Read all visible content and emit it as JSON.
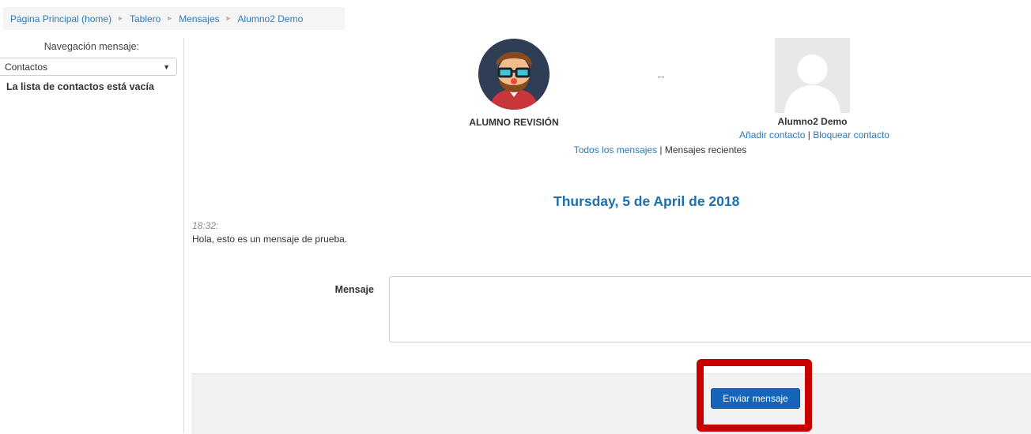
{
  "breadcrumb": {
    "items": [
      "Página Principal (home)",
      "Tablero",
      "Mensajes",
      "Alumno2 Demo"
    ],
    "separator": "►"
  },
  "sidebar": {
    "nav_label": "Navegación mensaje:",
    "select_value": "Contactos",
    "empty_text": "La lista de contactos está vacía"
  },
  "conversation": {
    "me_name": "ALUMNO REVISIÓN",
    "other_name": "Alumno2 Demo",
    "add_contact": "Añadir contacto",
    "block_contact": "Bloquear contacto",
    "action_separator": " | ",
    "all_messages": "Todos los mensajes",
    "recent_messages": "Mensajes recientes",
    "swap_glyph": "↔"
  },
  "messages": {
    "day": "Thursday, 5 de April de 2018",
    "items": [
      {
        "time": "18:32:",
        "text": "Hola, esto es un mensaje de prueba."
      }
    ]
  },
  "form": {
    "label": "Mensaje",
    "value": "",
    "send_label": "Enviar mensaje"
  },
  "colors": {
    "link": "#2a7ab8",
    "heading": "#1f6fa8",
    "button": "#1566b9",
    "highlight": "#c80000"
  }
}
